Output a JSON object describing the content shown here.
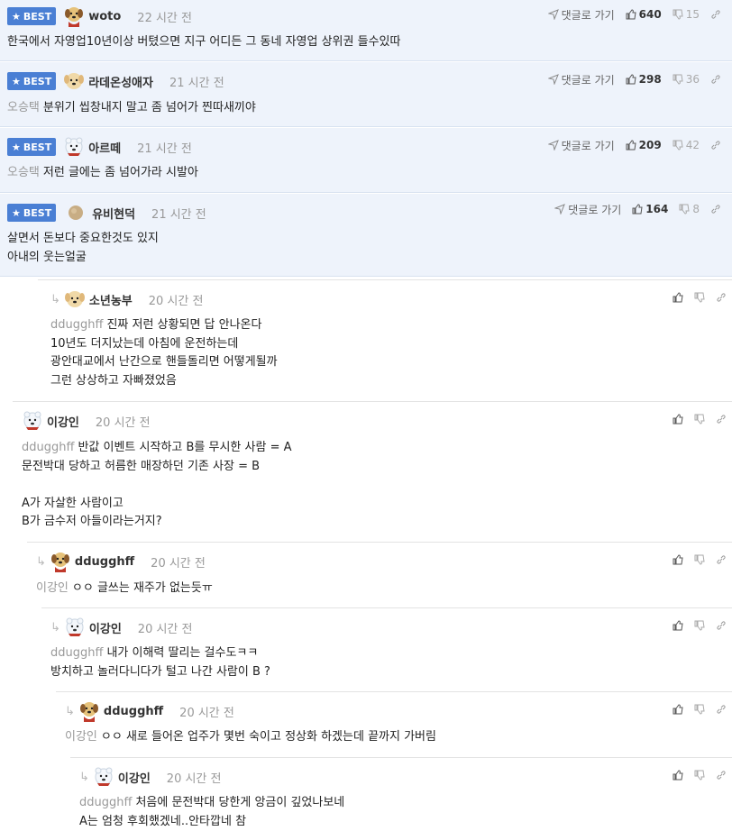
{
  "best_label": "BEST",
  "goto_label": "댓글로 가기",
  "best_comments": [
    {
      "nick": "woto",
      "time": "22 시간 전",
      "likes": "640",
      "dislikes": "15",
      "mention": "",
      "text": "한국에서 자영업10년이상 버텼으면 지구 어디든 그 동네 자영업 상위권 들수있따",
      "avatar": "dog"
    },
    {
      "nick": "라데온성애자",
      "time": "21 시간 전",
      "likes": "298",
      "dislikes": "36",
      "mention": "오승택",
      "text": "분위기 씹창내지 말고 좀 넘어가 찐따새끼야",
      "avatar": "puppy"
    },
    {
      "nick": "아르떼",
      "time": "21 시간 전",
      "likes": "209",
      "dislikes": "42",
      "mention": "오승택",
      "text": "저런 글에는 좀 넘어가라 시발아",
      "avatar": "bear"
    },
    {
      "nick": "유비현덕",
      "time": "21 시간 전",
      "likes": "164",
      "dislikes": "8",
      "mention": "",
      "text": "살면서 돈보다 중요한것도 있지\n아내의 웃는얼굴",
      "avatar": "ball"
    }
  ],
  "replies": [
    {
      "nick": "소년농부",
      "time": "20 시간 전",
      "mention": "ddugghff",
      "text": "진짜 저런 상황되면 답 안나온다\n10년도 더지났는데 아침에 운전하는데\n광안대교에서 난간으로 핸들돌리면 어떻게될까\n그런 상상하고 자빠졌었음",
      "avatar": "puppy",
      "arrow": true
    },
    {
      "nick": "이강인",
      "time": "20 시간 전",
      "mention": "ddugghff",
      "text": "반값 이벤트 시작하고 B를 무시한 사람 = A\n문전박대 당하고 허름한 매장하던 기존 사장 = B\n\nA가 자살한 사람이고\nB가 금수저 아들이라는거지?",
      "avatar": "bear",
      "arrow": false
    },
    {
      "nick": "ddugghff",
      "time": "20 시간 전",
      "mention": "이강인",
      "text": "ㅇㅇ 글쓰는 재주가 없는듯ㅠ",
      "avatar": "dog",
      "arrow": true
    },
    {
      "nick": "이강인",
      "time": "20 시간 전",
      "mention": "ddugghff",
      "text": "내가 이해력 딸리는 걸수도ㅋㅋ\n방치하고 놀러다니다가 털고 나간 사람이 B ?",
      "avatar": "bear",
      "arrow": true
    },
    {
      "nick": "ddugghff",
      "time": "20 시간 전",
      "mention": "이강인",
      "text": "ㅇㅇ 새로 들어온 업주가 몇번 숙이고 정상화 하겠는데 끝까지 가버림",
      "avatar": "dog",
      "arrow": true
    },
    {
      "nick": "이강인",
      "time": "20 시간 전",
      "mention": "ddugghff",
      "text": "처음에 문전박대 당한게 앙금이 깊었나보네\nA는 엄청 후회했겠네..안타깝네 참",
      "avatar": "bear",
      "arrow": true
    }
  ]
}
